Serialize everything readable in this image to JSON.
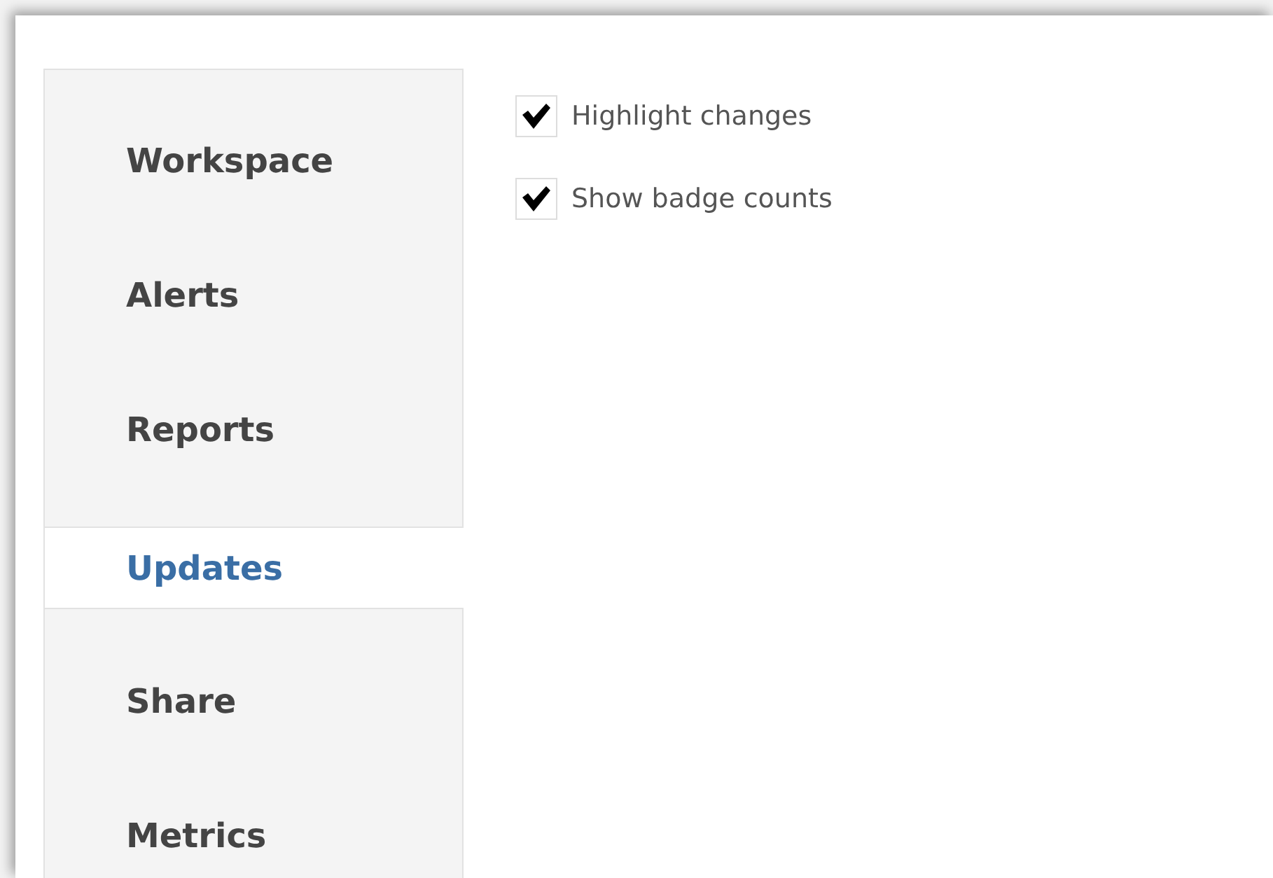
{
  "sidebar": {
    "items": [
      {
        "label": "Workspace",
        "selected": false
      },
      {
        "label": "Alerts",
        "selected": false
      },
      {
        "label": "Reports",
        "selected": false
      },
      {
        "label": "Updates",
        "selected": true
      },
      {
        "label": "Share",
        "selected": false
      },
      {
        "label": "Metrics",
        "selected": false
      }
    ]
  },
  "options": [
    {
      "label": "Highlight changes",
      "checked": true
    },
    {
      "label": "Show badge counts",
      "checked": true
    }
  ]
}
